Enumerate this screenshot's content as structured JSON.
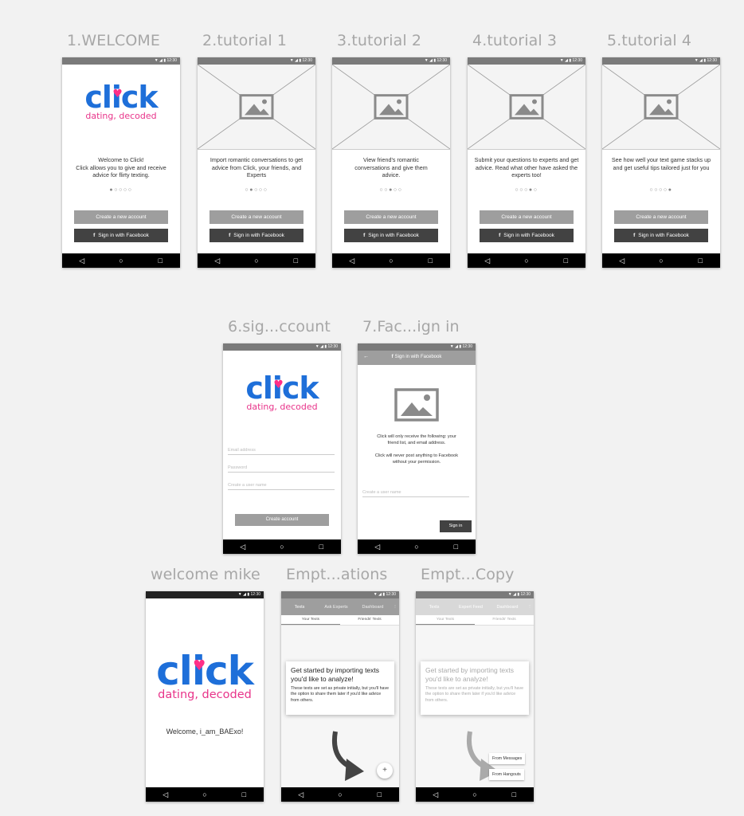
{
  "statusbar": {
    "time": "▼ ◢ ▮ 12:30"
  },
  "navbar": {
    "back": "◁",
    "home": "○",
    "recent": "□"
  },
  "logo": {
    "word": "click",
    "tagline": "dating, decoded"
  },
  "boards": {
    "b1": {
      "title": "1.WELCOME",
      "text": "Welcome to Click!\nClick allows you to give and receive advice for flirty texting.",
      "dots": "●○○○○",
      "create": "Create a new account",
      "facebook": "Sign in with Facebook"
    },
    "b2": {
      "title": "2.tutorial 1",
      "text": "Import romantic conversations to get advice from Click, your friends, and Experts",
      "dots": "○●○○○",
      "create": "Create a new account",
      "facebook": "Sign in with Facebook"
    },
    "b3": {
      "title": "3.tutorial 2",
      "text": "View friend's romantic conversations and give them advice.",
      "dots": "○○●○○",
      "create": "Create a new account",
      "facebook": "Sign in with Facebook"
    },
    "b4": {
      "title": "4.tutorial 3",
      "text": "Submit your questions to experts and get advice. Read what other have asked the experts too!",
      "dots": "○○○●○",
      "create": "Create a new account",
      "facebook": "Sign in with Facebook"
    },
    "b5": {
      "title": "5.tutorial 4",
      "text": "See how well your text game stacks up and get useful tips tailored just for you",
      "dots": "○○○○●",
      "create": "Create a new account",
      "facebook": "Sign in with Facebook"
    },
    "b6": {
      "title": "6.sig...ccount",
      "email": "Email address",
      "password": "Password",
      "username": "Create a user name",
      "submit": "Create account"
    },
    "b7": {
      "title": "7.Fac...ign in",
      "appbar": "Sign in with Facebook",
      "back": "←",
      "text1": "Click will only receive the following: your friend list, and email address.",
      "text2": "Click will never post anything to Facebook without your permission.",
      "username": "Create a user name",
      "signin": "Sign in"
    },
    "b8": {
      "title": "welcome mike",
      "welcome": "Welcome, i_am_BAExo!"
    },
    "b9": {
      "title": "Empt...ations",
      "tabs": [
        "Texts",
        "Ask Experts",
        "Dashboard"
      ],
      "menu_icon": "⋮",
      "subtabs": [
        "Your Texts",
        "Friends' Texts"
      ],
      "card_title": "Get started by importing texts you'd like to analyze!",
      "card_body": "These texts are set as private initially, but you'll have the option to share them later if you'd like advice from others.",
      "fab": "+"
    },
    "b10": {
      "title": "Empt...Copy",
      "tabs": [
        "Texts",
        "Expert Feed",
        "Dashboard"
      ],
      "menu_icon": "⋮",
      "subtabs": [
        "Your Texts",
        "Friends' Texts"
      ],
      "card_title": "Get started by importing texts you'd like to analyze!",
      "card_body": "These texts are set as private initially, but you'll have the option to share them later if you'd like advice from others.",
      "menu": [
        "From Messages",
        "From Hangouts"
      ]
    }
  },
  "colors": {
    "brand_blue": "#1e6fd9",
    "brand_pink": "#ff2f87",
    "button_grey": "#9e9e9e",
    "button_dark": "#424242"
  },
  "icons": {
    "placeholder": "image-placeholder-icon",
    "facebook": "facebook-icon",
    "arrow": "curved-arrow-icon"
  }
}
